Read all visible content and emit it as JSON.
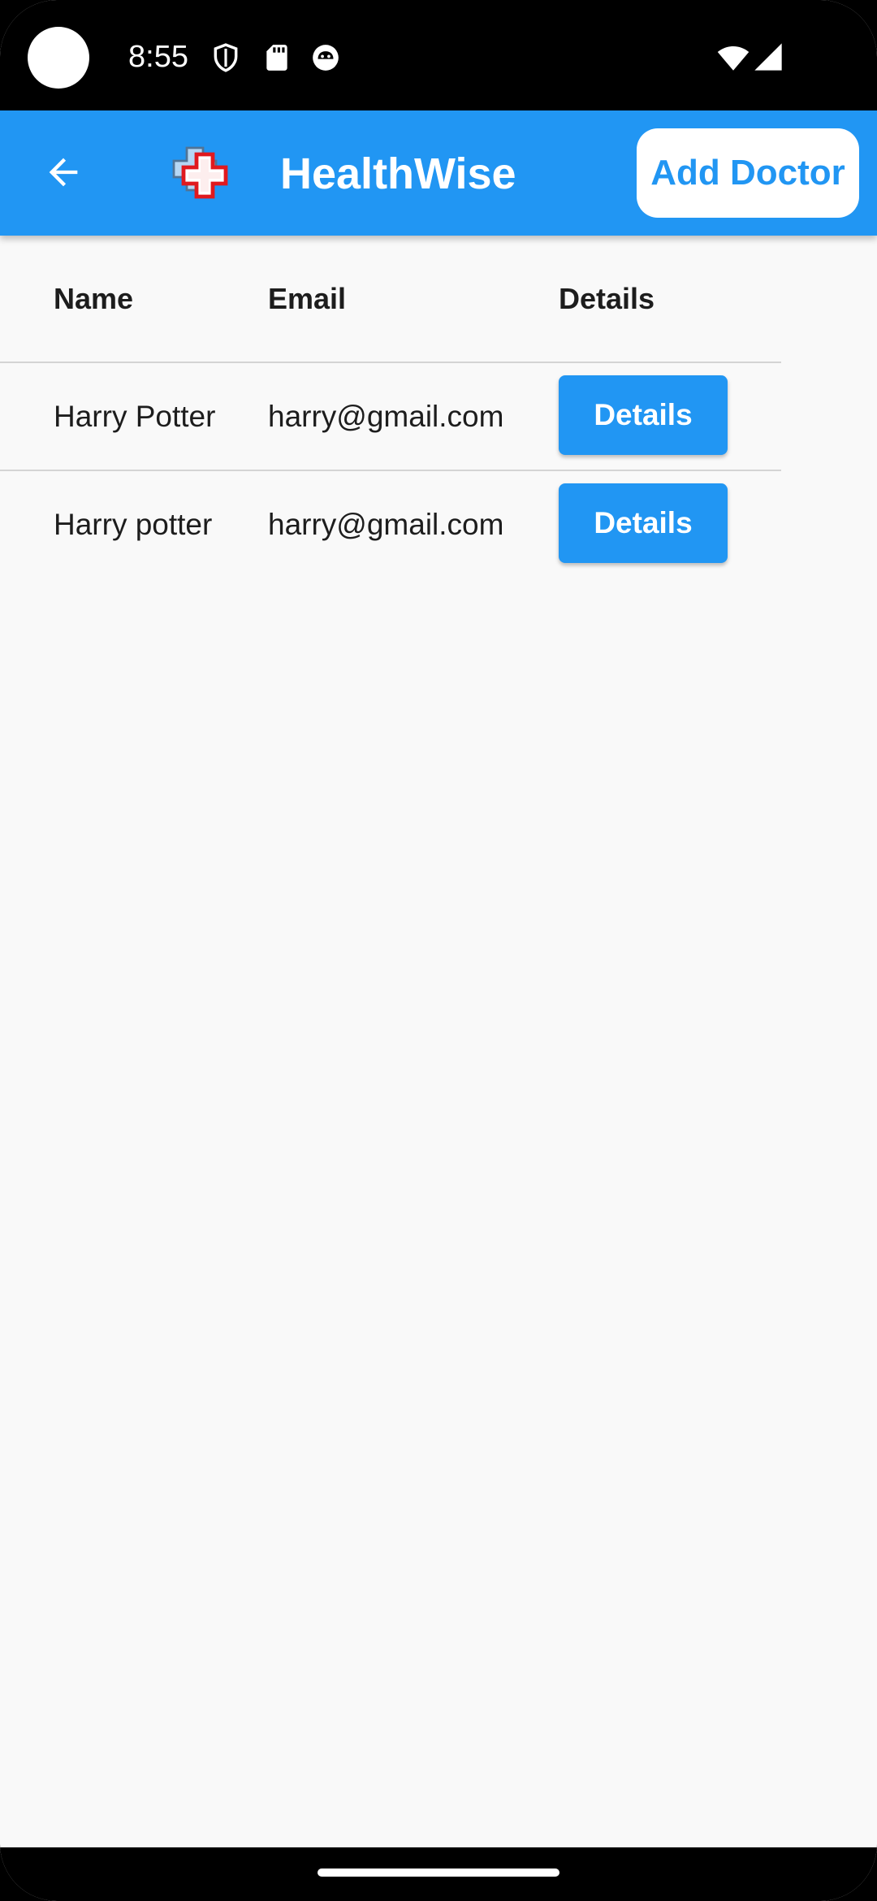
{
  "status_bar": {
    "time": "8:55",
    "icons": [
      "shield-icon",
      "sd-card-icon",
      "notification-face-icon",
      "wifi-icon",
      "cellular-signal-icon"
    ]
  },
  "app_bar": {
    "back_icon": "arrow-back-icon",
    "logo_icon": "medical-cross-logo",
    "title": "HealthWise",
    "add_doctor_label": "Add Doctor",
    "color": "#2196f3"
  },
  "table": {
    "headers": [
      "Name",
      "Email",
      "Details"
    ],
    "rows": [
      {
        "name": "Harry Potter",
        "email": "harry@gmail.com",
        "button_label": "Details"
      },
      {
        "name": "Harry potter",
        "email": "harry@gmail.com",
        "button_label": "Details"
      }
    ]
  }
}
